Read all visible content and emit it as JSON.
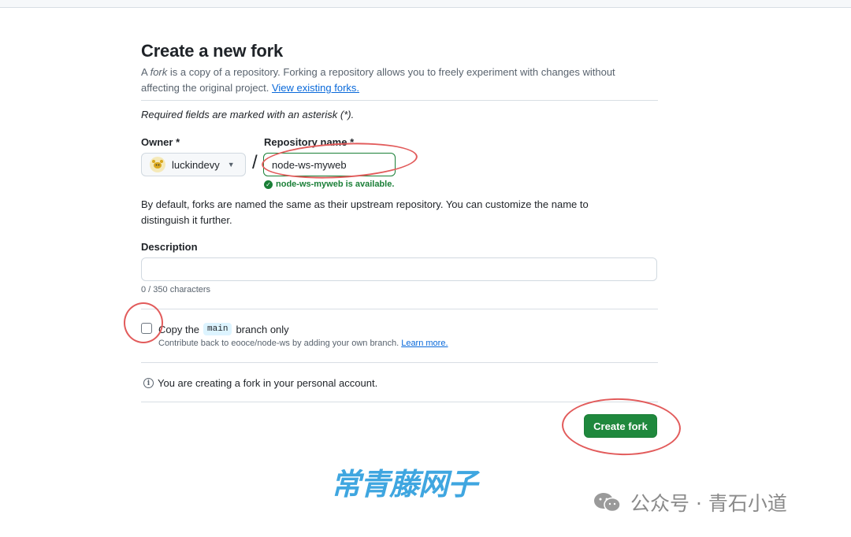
{
  "page": {
    "title": "Create a new fork",
    "intro_a": "A ",
    "intro_fork": "fork",
    "intro_b": " is a copy of a repository. Forking a repository allows you to freely experiment with changes without affecting the original project. ",
    "intro_link": "View existing forks.",
    "required_note": "Required fields are marked with an asterisk (*)."
  },
  "owner": {
    "label": "Owner *",
    "value": "luckindevy"
  },
  "repo": {
    "label": "Repository name *",
    "value": "node-ws-myweb",
    "available_msg": "node-ws-myweb is available."
  },
  "default_note": "By default, forks are named the same as their upstream repository. You can customize the name to distinguish it further.",
  "description": {
    "label": "Description",
    "value": "",
    "counter": "0 / 350 characters"
  },
  "copy_branch": {
    "label_a": "Copy the",
    "branch": "main",
    "label_b": "branch only",
    "checked": false,
    "help": "Contribute back to eooce/node-ws by adding your own branch. ",
    "help_link": "Learn more."
  },
  "info_text": "You are creating a fork in your personal account.",
  "submit_label": "Create fork",
  "watermark": {
    "brand": "常青藤网子",
    "account": "公众号 · 青石小道"
  },
  "colors": {
    "primary_button": "#1f883d",
    "success": "#1a7f37",
    "link": "#0969da",
    "annotation": "#e25b5b"
  }
}
